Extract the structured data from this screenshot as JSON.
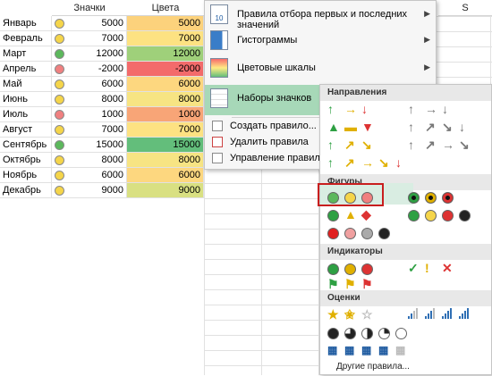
{
  "columns": {
    "b": "Значки",
    "c": "Цвета",
    "s": "S"
  },
  "rows": [
    {
      "month": "Январь",
      "v": "5000",
      "c": "5000",
      "dot": "#f5d54a",
      "bg": "#fcd27c"
    },
    {
      "month": "Февраль",
      "v": "7000",
      "c": "7000",
      "dot": "#f5d54a",
      "bg": "#fde282"
    },
    {
      "month": "Март",
      "v": "12000",
      "c": "12000",
      "dot": "#5cb85c",
      "bg": "#9fd07a"
    },
    {
      "month": "Апрель",
      "v": "-2000",
      "c": "-2000",
      "dot": "#f08080",
      "bg": "#f36b6b"
    },
    {
      "month": "Май",
      "v": "6000",
      "c": "6000",
      "dot": "#f5d54a",
      "bg": "#fdd77f"
    },
    {
      "month": "Июнь",
      "v": "8000",
      "c": "8000",
      "dot": "#f5d54a",
      "bg": "#f7e483"
    },
    {
      "month": "Июль",
      "v": "1000",
      "c": "1000",
      "dot": "#f08080",
      "bg": "#f8a577"
    },
    {
      "month": "Август",
      "v": "7000",
      "c": "7000",
      "dot": "#f5d54a",
      "bg": "#fde282"
    },
    {
      "month": "Сентябрь",
      "v": "15000",
      "c": "15000",
      "dot": "#5cb85c",
      "bg": "#63be7b"
    },
    {
      "month": "Октябрь",
      "v": "8000",
      "c": "8000",
      "dot": "#f5d54a",
      "bg": "#f7e483"
    },
    {
      "month": "Ноябрь",
      "v": "6000",
      "c": "6000",
      "dot": "#f5d54a",
      "bg": "#fdd77f"
    },
    {
      "month": "Декабрь",
      "v": "9000",
      "c": "9000",
      "dot": "#f5d54a",
      "bg": "#d9e082"
    }
  ],
  "menu": {
    "top_rules": "Правила отбора первых и последних значений",
    "data_bars": "Гистограммы",
    "color_scales": "Цветовые шкалы",
    "icon_sets": "Наборы значков",
    "new_rule": "Создать правило...",
    "clear_rules": "Удалить правила",
    "manage_rules": "Управление правилами...",
    "icon_10": "10"
  },
  "submenu": {
    "directions": "Направления",
    "shapes": "Фигуры",
    "indicators": "Индикаторы",
    "ratings": "Оценки",
    "more_rules": "Другие правила...",
    "indicator_glyphs": [
      "✓",
      "!",
      "✕"
    ]
  }
}
